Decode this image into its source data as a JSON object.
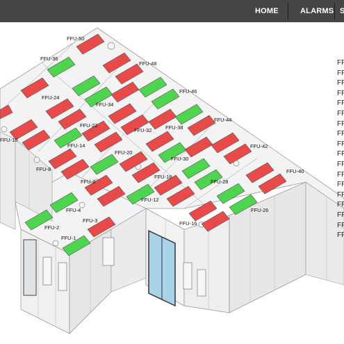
{
  "nav": {
    "home": "HOME",
    "alarms": "ALARMS",
    "third_partial": "S"
  },
  "colors": {
    "ok": "#4fd44f",
    "alarm": "#e84a4a",
    "topbar": "#454545"
  },
  "ffu_status": {
    "ok": [
      "FFU-36",
      "FFU-34",
      "FFU-46",
      "FFU-38",
      "FFU-14",
      "FFU-20",
      "FFU-30",
      "FFU-28",
      "FFU-12",
      "FFU-4",
      "FFU-2",
      "FFU-1",
      "FFU-26"
    ],
    "alarm": [
      "FFU-50",
      "FFU-48",
      "FFU-24",
      "FFU-32",
      "FFU-10",
      "FFU-22",
      "FFU-44",
      "FFU-42",
      "FFU-40",
      "FFU-8",
      "FFU-6",
      "FFU-18",
      "FFU-16",
      "FFU-3"
    ]
  },
  "labels": {
    "ffu50": "FFU-50",
    "ffu36": "FFU-36",
    "ffu48": "FFU-48",
    "ffu46": "FFU-46",
    "ffu24": "FFU-24",
    "ffu34": "FFU-34",
    "ffu44": "FFU-44",
    "ffu22": "FFU-22",
    "ffu32": "FFU-32",
    "ffu38": "FFU-38",
    "ffu42": "FFU-42",
    "ffu10": "FFU-10",
    "ffu14": "FFU-14",
    "ffu30": "FFU-30",
    "ffu20": "FFU-20",
    "ffu8": "FFU-8",
    "ffu40": "FFU-40",
    "ffu28": "FFU-28",
    "ffu18": "FFU-18",
    "ffu6": "FFU-6",
    "ffu12": "FFU-12",
    "ffu4": "FFU-4",
    "ffu26": "FFU-26",
    "ffu3": "FFU-3",
    "ffu2": "FFU-2",
    "ffu16": "FFU-16",
    "ffu1": "FFU-1"
  },
  "side_list": [
    "FF",
    "FF",
    "FF",
    "FF",
    "FF",
    "FF",
    "FF",
    "FF",
    "FF",
    "FF",
    "FF",
    "FF",
    "FF",
    "FF",
    "FF",
    "FF",
    "FF",
    "FF"
  ]
}
